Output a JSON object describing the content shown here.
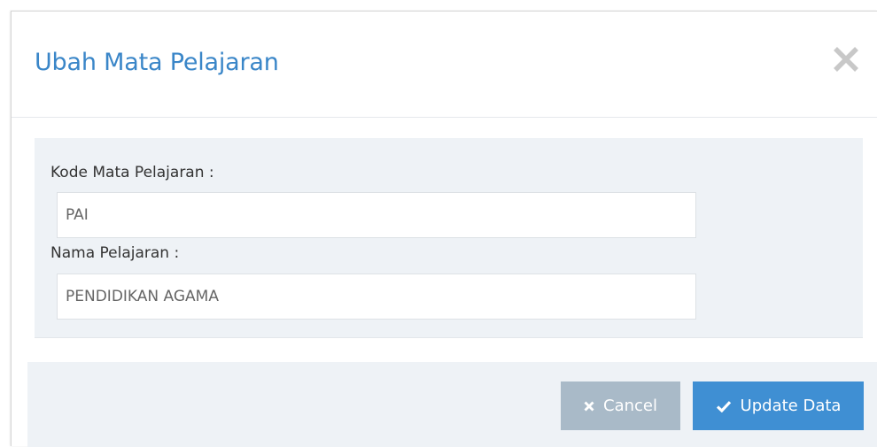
{
  "modal": {
    "title": "Ubah Mata Pelajaran",
    "close_icon": "times-icon"
  },
  "form": {
    "kode": {
      "label": "Kode Mata Pelajaran :",
      "value": "PAI"
    },
    "nama": {
      "label": "Nama Pelajaran :",
      "value": "PENDIDIKAN AGAMA"
    }
  },
  "footer": {
    "cancel_label": "Cancel",
    "cancel_icon": "times-icon",
    "update_label": "Update Data",
    "update_icon": "check-icon"
  },
  "colors": {
    "title": "#3a86c8",
    "panel_bg": "#eef2f6",
    "cancel_bg": "#a9bac8",
    "update_bg": "#3f8fd3",
    "close_icon": "#c8c8c8"
  }
}
